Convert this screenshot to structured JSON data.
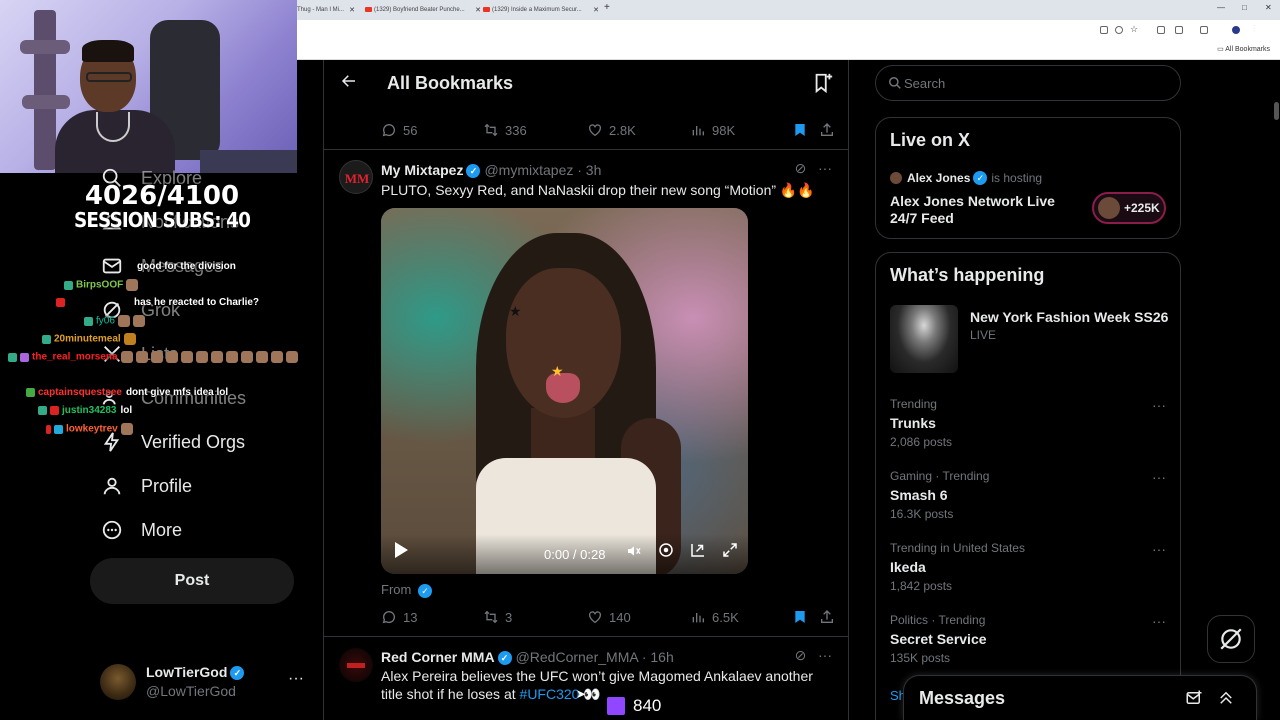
{
  "browser": {
    "tabs": [
      {
        "label": "Thug - Man I Mi..."
      },
      {
        "label": "(1329) Boyfriend Beater Punche..."
      },
      {
        "label": "(1329) Inside a Maximum Secur..."
      }
    ],
    "bookmarks_label": "All Bookmarks"
  },
  "overlay": {
    "counter": "4026/4100",
    "session": "SESSION SUBS: 40",
    "chat": [
      {
        "user": "",
        "msg": "good for the division",
        "color": "#ffffff",
        "badge": ""
      },
      {
        "user": "BirpsOOF",
        "msg": "",
        "color": "#7ec850",
        "badge": "#3a8"
      },
      {
        "user": "",
        "msg": "has he reacted to Charlie?",
        "color": "#3355ff",
        "badge": "#d22"
      },
      {
        "user": "fy06",
        "msg": "",
        "color": "#00c0a0",
        "badge": "#3a8"
      },
      {
        "user": "20minutemeal",
        "msg": "",
        "color": "#e0a020",
        "badge": "#3a8"
      },
      {
        "user": "the_real_morsena",
        "msg": "",
        "color": "#ff2020",
        "badge": "#a6d"
      },
      {
        "user": "captainsquestsee",
        "msg": "dont give mfs idea lol",
        "color": "#ff3030",
        "badge": "#4a4"
      },
      {
        "user": "justin34283",
        "msg": "lol",
        "color": "#20c060",
        "badge": "#d22"
      },
      {
        "user": "lowkeytrev",
        "msg": "",
        "color": "#ff6030",
        "badge": "#2ad"
      }
    ]
  },
  "nav": {
    "explore": "Explore",
    "notifications": "Notifications",
    "messages": "Messages",
    "grok": "Grok",
    "lists": "Lists",
    "communities": "Communities",
    "verified_orgs": "Verified Orgs",
    "profile": "Profile",
    "more": "More",
    "post": "Post"
  },
  "account": {
    "name": "LowTierGod",
    "handle": "@LowTierGod"
  },
  "header": {
    "title": "All Bookmarks"
  },
  "tweets": [
    {
      "replies": "56",
      "reposts": "336",
      "likes": "2.8K",
      "views": "98K"
    },
    {
      "name": "My Mixtapez",
      "handle": "@mymixtapez · 3h",
      "text": "PLUTO, Sexyy Red, and NaNaskii drop their new song “Motion” 🔥🔥",
      "video_time": "0:00 / 0:28",
      "from": "From",
      "replies": "13",
      "reposts": "3",
      "likes": "140",
      "views": "6.5K"
    },
    {
      "name": "Red Corner MMA",
      "handle": "@RedCorner_MMA · 16h",
      "text_before": "Alex Pereira believes the UFC won’t give Magomed Ankalaev another title shot if he loses at ",
      "hashtag": "#UFC320",
      "text_after": " 👀"
    }
  ],
  "sidebar": {
    "search_placeholder": "Search",
    "live_title": "Live on X",
    "live_host": "Alex Jones",
    "live_hosting": "is hosting",
    "live_stream": "Alex Jones Network Live 24/7 Feed",
    "live_count": "+225K",
    "happening_title": "What’s happening",
    "featured": {
      "name": "New York Fashion Week SS26",
      "status": "LIVE"
    },
    "trends": [
      {
        "category": "Trending",
        "name": "Trunks",
        "posts": "2,086 posts"
      },
      {
        "category": "Gaming · Trending",
        "name": "Smash 6",
        "posts": "16.3K posts"
      },
      {
        "category": "Trending in United States",
        "name": "Ikeda",
        "posts": "1,842 posts"
      },
      {
        "category": "Politics · Trending",
        "name": "Secret Service",
        "posts": "135K posts"
      }
    ],
    "show_more": "Sh"
  },
  "messages_drawer": {
    "title": "Messages"
  },
  "twitch": {
    "viewers": "840"
  }
}
